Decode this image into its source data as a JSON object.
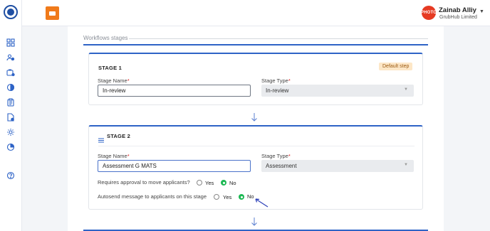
{
  "header": {
    "user_name": "Zainab Alliy",
    "user_org": "GrubHub Limited",
    "avatar_text": "PHOTO"
  },
  "section": {
    "title": "Workflows stages"
  },
  "stage1": {
    "title": "STAGE 1",
    "badge": "Default step",
    "name_label": "Stage Name",
    "name_value": "In-review",
    "type_label": "Stage Type",
    "type_value": "In-review"
  },
  "stage2": {
    "title": "STAGE 2",
    "name_label": "Stage Name",
    "name_value": "Assessment G MATS",
    "type_label": "Stage Type",
    "type_value": "Assessment",
    "approval_question": "Requires approval to move applicants?",
    "autosend_question": "Autosend message to applicants on this stage",
    "yes_label": "Yes",
    "no_label": "No",
    "approval_selected": "No",
    "autosend_selected": "No"
  },
  "required_mark": "*",
  "colors": {
    "accent": "#2e63c6",
    "success": "#1db954",
    "brand": "#f07a1a",
    "avatar": "#e63a22"
  },
  "icons": [
    "app-logo-icon",
    "dashboard-icon",
    "users-icon",
    "jobs-icon",
    "pipeline-icon",
    "clipboard-icon",
    "file-user-icon",
    "settings-icon",
    "analytics-icon",
    "help-icon"
  ]
}
